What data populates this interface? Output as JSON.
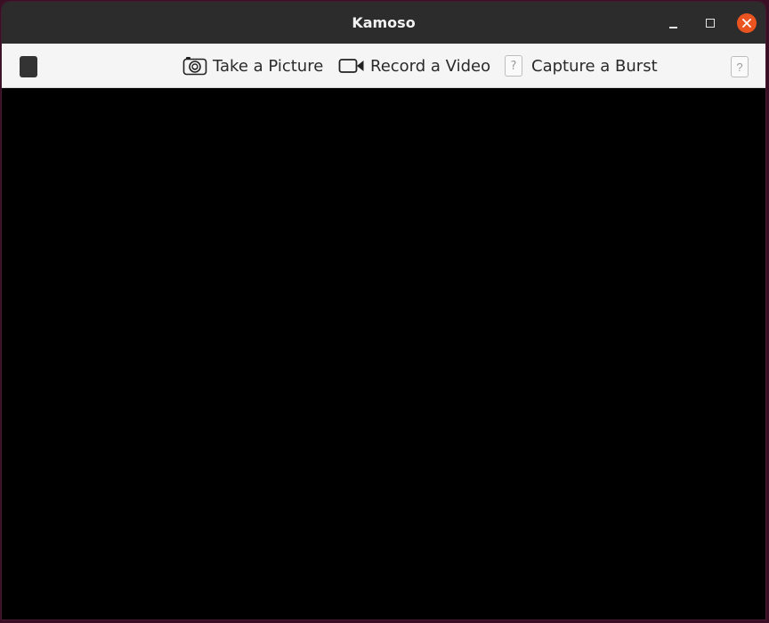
{
  "window": {
    "title": "Kamoso"
  },
  "toolbar": {
    "take_picture_label": "Take a Picture",
    "record_video_label": "Record a Video",
    "capture_burst_label": "Capture a Burst",
    "missing_icon_glyph": "?"
  },
  "icons": {
    "left": "sidebar-toggle-icon",
    "picture": "camera-icon",
    "video": "video-camera-icon",
    "burst": "missing-image-icon",
    "right": "missing-image-icon",
    "minimize": "minimize-icon",
    "maximize": "maximize-icon",
    "close": "close-icon"
  },
  "colors": {
    "titlebar": "#2c2c2c",
    "toolbar": "#f5f5f5",
    "close_button": "#e95420",
    "viewport": "#000000"
  }
}
